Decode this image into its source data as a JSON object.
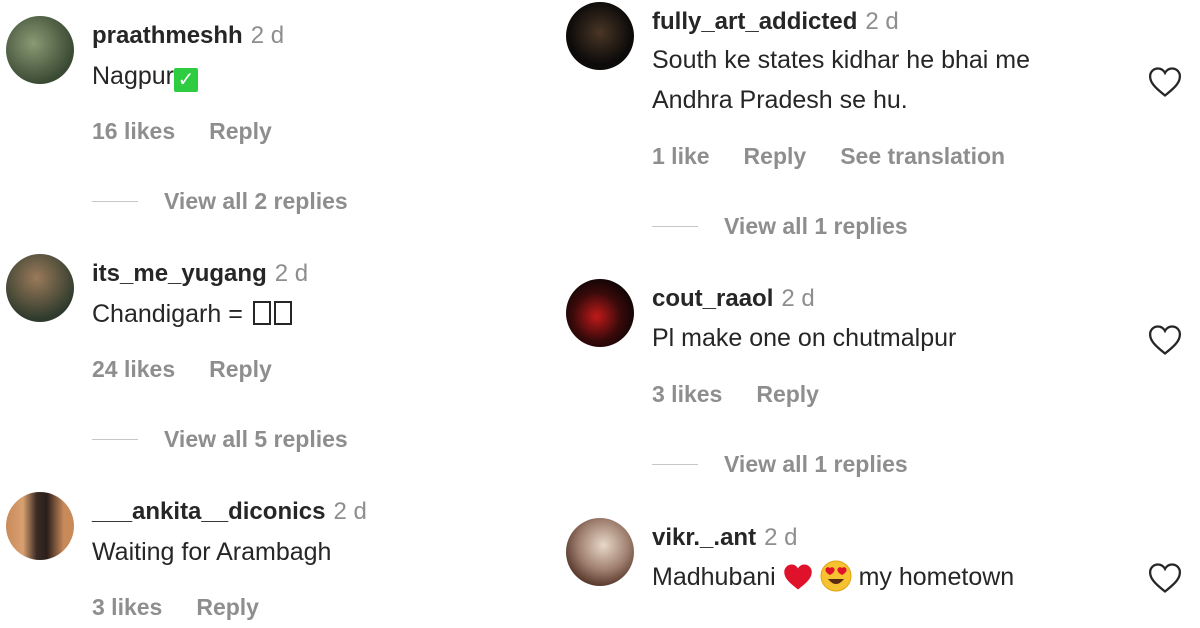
{
  "left_comments": [
    {
      "username": "praathmeshh",
      "time": "2 d",
      "text": "Nagpur",
      "text_suffix_icon": "green-check-icon",
      "likes": "16 likes",
      "reply": "Reply",
      "view_replies": "View all 2 replies",
      "avatar_colors": [
        "#6d7a5c",
        "#2f3a2a"
      ]
    },
    {
      "username": "its_me_yugang",
      "time": "2 d",
      "text": "Chandigarh = ",
      "text_suffix_icon": "missing-glyph-boxes",
      "likes": "24 likes",
      "reply": "Reply",
      "view_replies": "View all 5 replies",
      "avatar_colors": [
        "#7b5a3c",
        "#2b3b2f"
      ]
    },
    {
      "username": "___ankita__diconics",
      "time": "2 d",
      "text": "Waiting for Arambagh",
      "likes": "3 likes",
      "reply": "Reply",
      "avatar_colors": [
        "#b8734a",
        "#3a2b24"
      ]
    }
  ],
  "right_comments": [
    {
      "username": "fully_art_addicted",
      "time": "2 d",
      "text_lines": [
        "South ke states kidhar he bhai me",
        "Andhra Pradesh se hu."
      ],
      "likes": "1 like",
      "reply": "Reply",
      "translate": "See translation",
      "view_replies": "View all 1 replies",
      "avatar_colors": [
        "#3a2a20",
        "#0c0c0c"
      ]
    },
    {
      "username": "cout_raaol",
      "time": "2 d",
      "text": "Pl make one on chutmalpur",
      "likes": "3 likes",
      "reply": "Reply",
      "view_replies": "View all 1 replies",
      "avatar_colors": [
        "#b01818",
        "#140606"
      ]
    },
    {
      "username": "vikr._.ant",
      "time": "2 d",
      "text": "Madhubani",
      "text_after_emojis": "my hometown",
      "emojis": [
        "red-heart-icon",
        "heart-eyes-face-icon"
      ],
      "avatar_colors": [
        "#d8c8b8",
        "#5a3a2a"
      ]
    }
  ],
  "colors": {
    "text_primary": "#262626",
    "text_secondary": "#8e8e8e",
    "background": "#ffffff"
  }
}
